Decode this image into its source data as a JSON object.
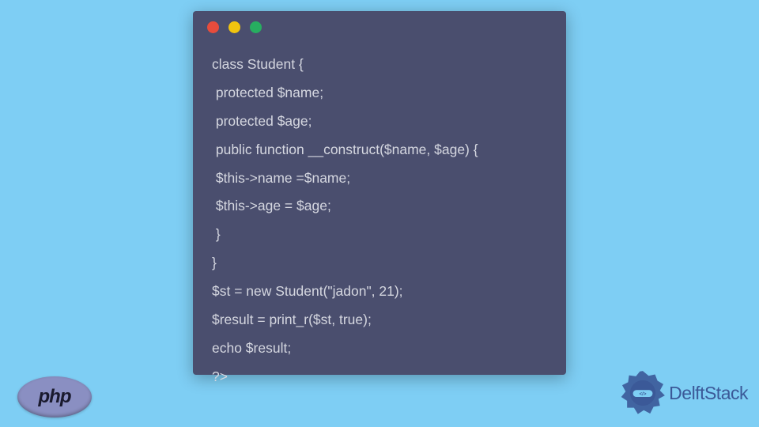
{
  "code": {
    "lines": [
      "class Student {",
      " protected $name;",
      " protected $age;",
      " public function __construct($name, $age) {",
      " $this->name =$name;",
      " $this->age = $age;",
      " }",
      "}",
      "$st = new Student(\"jadon\", 21);",
      "$result = print_r($st, true);",
      "echo $result;",
      "?>"
    ]
  },
  "php_badge": {
    "text": "php"
  },
  "brand": {
    "name": "DelftStack"
  }
}
